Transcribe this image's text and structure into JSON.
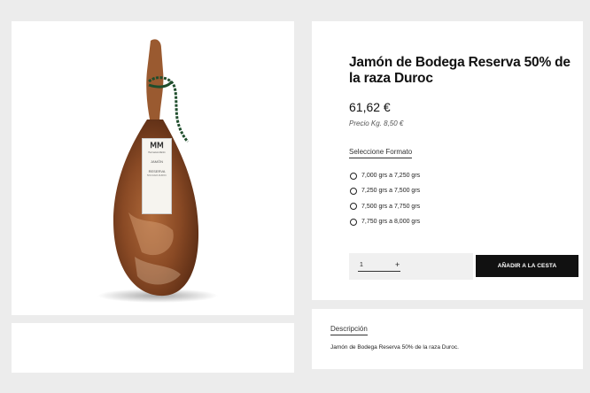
{
  "product": {
    "title": "Jamón de Bodega Reserva 50% de la raza Duroc",
    "price": "61,62 €",
    "unit_price": "Precio Kg. 8,50 €",
    "image_alt": "jamón product image"
  },
  "format": {
    "label": "Seleccione Formato",
    "options": [
      "7,000 grs a 7,250 grs",
      "7,250 grs a 7,500 grs",
      "7,500 grs a 7,750 grs",
      "7,750 grs a 8,000 grs"
    ]
  },
  "cart": {
    "quantity": "1",
    "plus": "+",
    "add_label": "AÑADIR A LA CESTA"
  },
  "description": {
    "heading": "Descripción",
    "text": "Jamón de Bodega Reserva 50% de la raza Duroc."
  },
  "label_tag": {
    "brand": "Hermanos Martín",
    "line1": "JAMÓN",
    "line2": "RESERVA",
    "line3": "50% RAZA DUROC"
  },
  "colors": {
    "background": "#ececec",
    "button": "#111111",
    "ham": "#8a4a25"
  }
}
